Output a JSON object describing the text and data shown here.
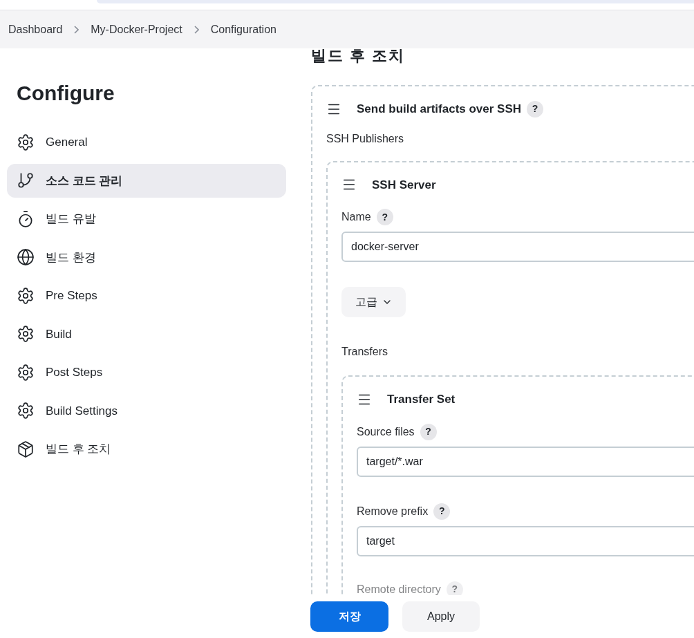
{
  "breadcrumbs": [
    {
      "label": "Dashboard"
    },
    {
      "label": "My-Docker-Project"
    },
    {
      "label": "Configuration"
    }
  ],
  "sidebar": {
    "title": "Configure",
    "items": [
      {
        "label": "General",
        "kind": "gear",
        "selected": false
      },
      {
        "label": "소스 코드 관리",
        "kind": "branch",
        "selected": true
      },
      {
        "label": "빌드 유발",
        "kind": "timer",
        "selected": false
      },
      {
        "label": "빌드 환경",
        "kind": "globe",
        "selected": false
      },
      {
        "label": "Pre Steps",
        "kind": "gear",
        "selected": false
      },
      {
        "label": "Build",
        "kind": "gear",
        "selected": false
      },
      {
        "label": "Post Steps",
        "kind": "gear",
        "selected": false
      },
      {
        "label": "Build Settings",
        "kind": "gear",
        "selected": false
      },
      {
        "label": "빌드 후 조치",
        "kind": "package",
        "selected": false
      }
    ]
  },
  "section": {
    "title": "빌드 후 조치",
    "step": {
      "title": "Send build artifacts over SSH",
      "help": "?",
      "label": "SSH Publishers",
      "server": {
        "title": "SSH Server",
        "name_field": {
          "label": "Name",
          "help": "?",
          "value": "docker-server"
        },
        "advanced_button": "고급",
        "transfers_label": "Transfers",
        "transfer_set": {
          "title": "Transfer Set",
          "fields": [
            {
              "label": "Source files",
              "help": "?",
              "value": "target/*.war"
            },
            {
              "label": "Remove prefix",
              "help": "?",
              "value": "target"
            }
          ],
          "faded_field": {
            "label": "Remote directory",
            "help": "?"
          }
        }
      }
    }
  },
  "buttons": [
    {
      "label": "저장",
      "kind": "primary"
    },
    {
      "label": "Apply",
      "kind": "secondary"
    }
  ]
}
